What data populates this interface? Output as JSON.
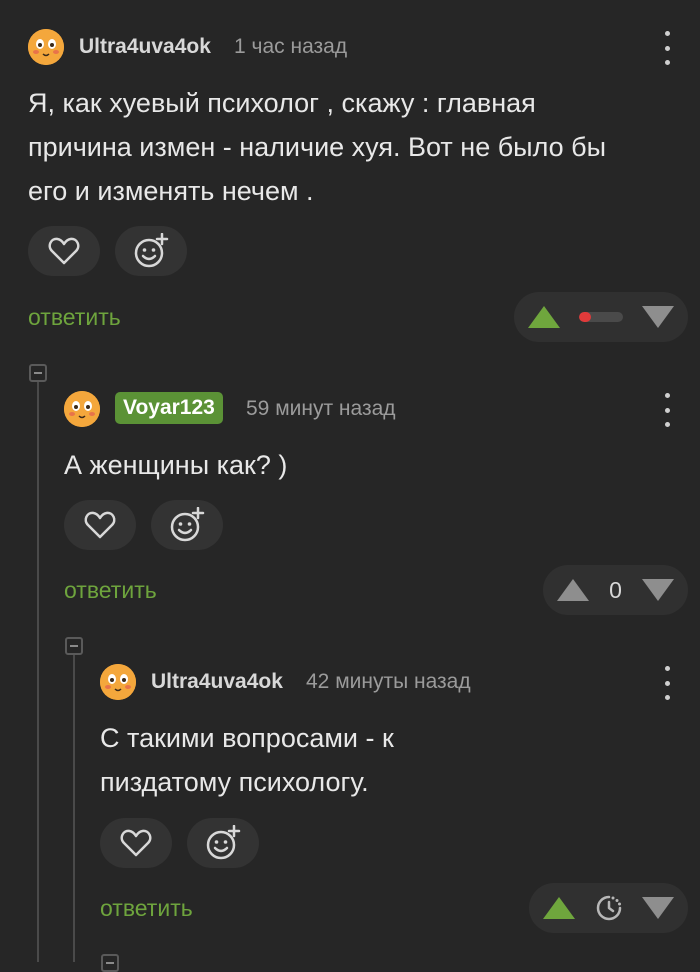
{
  "colors": {
    "background": "#262626",
    "accent": "#6ea43d",
    "badge": "#5b9236",
    "avatar": "#f4a73c",
    "upvote": "#6fa63d",
    "rating_bar": "#e03a3a"
  },
  "comments": [
    {
      "username": "Ultra4uva4ok",
      "time": "1 час назад",
      "text": [
        "Я, как хуевый психолог , скажу : главная",
        "причина измен - наличие хуя. Вот не было бы",
        "его и изменять нечем ."
      ],
      "reply": "ответить",
      "rating": {
        "mode": "bar",
        "value_fraction": 0.2
      }
    },
    {
      "username": "Voyar123",
      "time": "59 минут назад",
      "text": [
        "А женщины как? )"
      ],
      "reply": "ответить",
      "rating": {
        "mode": "number",
        "value": "0"
      }
    },
    {
      "username": "Ultra4uva4ok",
      "time": "42 минуты назад",
      "text": [
        "С такими вопросами - к",
        "пиздатому психологу."
      ],
      "reply": "ответить",
      "rating": {
        "mode": "pending",
        "icon": "clock-icon"
      }
    }
  ],
  "icons": {
    "like": "heart-icon",
    "reaction": "emoji-add-icon",
    "menu": "more-vertical-icon",
    "collapse": "collapse-icon"
  }
}
